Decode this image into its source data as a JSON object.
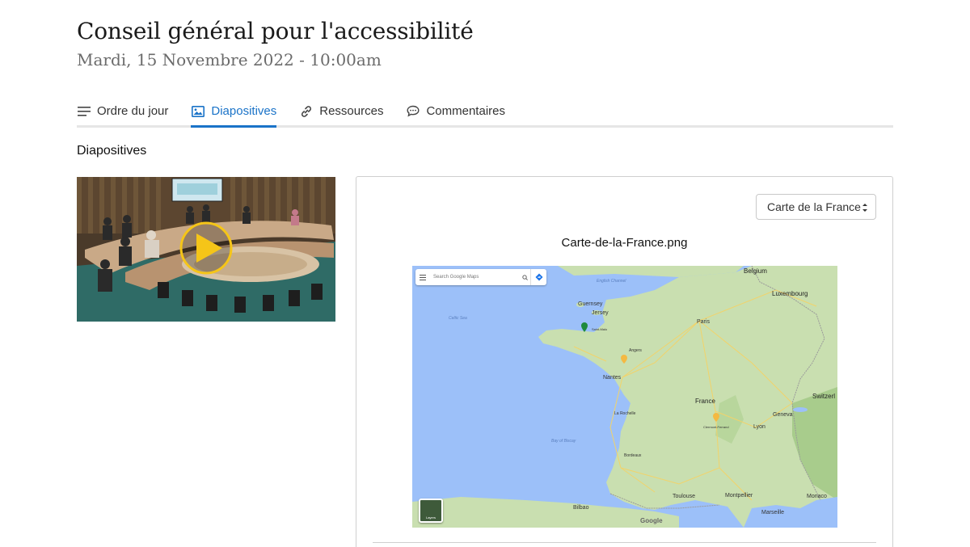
{
  "meeting": {
    "title": "Conseil général pour l'accessibilité",
    "datetime": "Mardi, 15 Novembre 2022 - 10:00am"
  },
  "tabs": [
    {
      "label": "Ordre du jour",
      "icon": "list-icon",
      "active": false
    },
    {
      "label": "Diapositives",
      "icon": "image-icon",
      "active": true
    },
    {
      "label": "Ressources",
      "icon": "link-icon",
      "active": false
    },
    {
      "label": "Commentaires",
      "icon": "comment-icon",
      "active": false
    }
  ],
  "section": {
    "label": "Diapositives"
  },
  "slide": {
    "selected": "Carte de la France",
    "filename": "Carte-de-la-France.png"
  },
  "map": {
    "search_placeholder": "Search Google Maps",
    "layers_label": "Layers",
    "attribution": "Google",
    "labels": {
      "belgium": "Belgium",
      "luxembourg": "Luxembourg",
      "english_channel": "English Channel",
      "guernsey": "Guernsey",
      "jersey": "Jersey",
      "celtic_sea": "Celtic Sea",
      "paris": "Paris",
      "nantes": "Nantes",
      "angers": "Angers",
      "france": "France",
      "switzerland": "Switzerl",
      "geneva": "Geneva",
      "lyon": "Lyon",
      "clermont": "Clermont-Ferrand",
      "bay_of_biscay": "Bay of Biscay",
      "la_rochelle": "La Rochelle",
      "bordeaux": "Bordeaux",
      "toulouse": "Toulouse",
      "montpellier": "Montpellier",
      "marseille": "Marseille",
      "monaco": "Monaco",
      "bilbao": "Bilbao",
      "saint_malo": "Saint-Malo"
    }
  },
  "colors": {
    "accent": "#1a73c8",
    "play_button": "#f5c518",
    "land": "#c9dfb0",
    "water": "#9cc0f9"
  }
}
